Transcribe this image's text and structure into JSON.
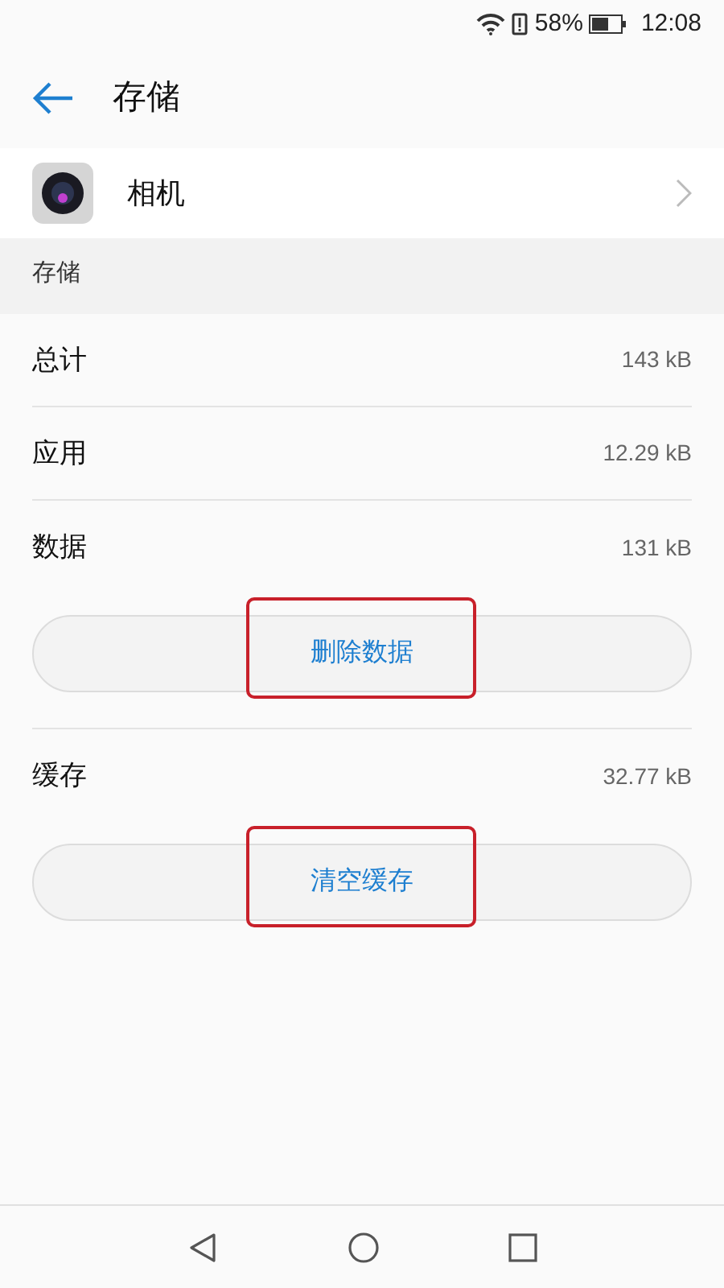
{
  "status_bar": {
    "battery_text": "58%",
    "time": "12:08"
  },
  "header": {
    "title": "存储"
  },
  "app": {
    "name": "相机"
  },
  "section": {
    "title": "存储"
  },
  "items": [
    {
      "kind": "row",
      "label": "总计",
      "value": "143 kB"
    },
    {
      "kind": "row",
      "label": "应用",
      "value": "12.29 kB"
    },
    {
      "kind": "row",
      "label": "数据",
      "value": "131 kB"
    },
    {
      "kind": "button",
      "label": "删除数据",
      "highlighted": true
    },
    {
      "kind": "row",
      "label": "缓存",
      "value": "32.77 kB"
    },
    {
      "kind": "button",
      "label": "清空缓存",
      "highlighted": true
    }
  ]
}
